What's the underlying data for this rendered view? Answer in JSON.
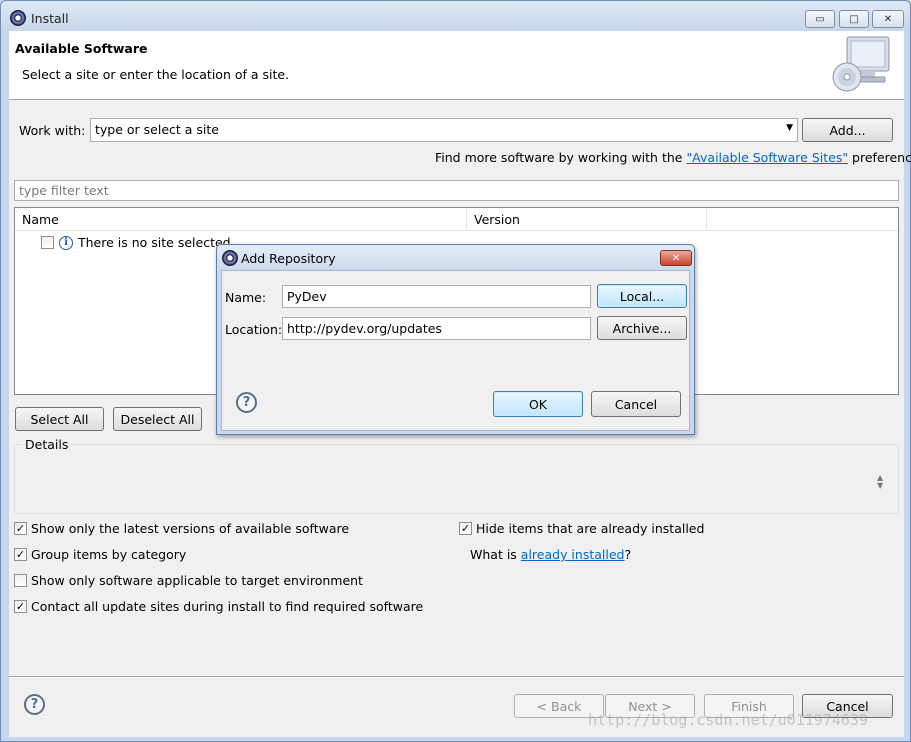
{
  "window": {
    "title": "Install",
    "min_glyph": "▭",
    "max_glyph": "□",
    "close_glyph": "✕"
  },
  "banner": {
    "title": "Available Software",
    "description": "Select a site or enter the location of a site."
  },
  "work_with": {
    "label": "Work with:",
    "value": "type or select a site",
    "add_button": "Add...",
    "info_prefix": "Find more software by working with the ",
    "info_link": "\"Available Software Sites\"",
    "info_suffix": " preferences."
  },
  "filter": {
    "placeholder": "type filter text"
  },
  "table": {
    "columns": [
      "Name",
      "Version"
    ],
    "empty_message": "There is no site selected."
  },
  "selection_buttons": {
    "select_all": "Select All",
    "deselect_all": "Deselect All"
  },
  "details": {
    "legend": "Details"
  },
  "options": {
    "latest_versions": {
      "label": "Show only the latest versions of available software",
      "checked": true
    },
    "group_by_category": {
      "label": "Group items by category",
      "checked": true
    },
    "target_env": {
      "label": "Show only software applicable to target environment",
      "checked": false
    },
    "contact_sites": {
      "label": "Contact all update sites during install to find required software",
      "checked": true
    },
    "hide_installed": {
      "label": "Hide items that are already installed",
      "checked": true
    },
    "what_is_prefix": "What is ",
    "what_is_link": "already installed",
    "what_is_suffix": "?"
  },
  "footer": {
    "back": "< Back",
    "next": "Next >",
    "finish": "Finish",
    "cancel": "Cancel"
  },
  "dialog": {
    "title": "Add Repository",
    "close_glyph": "✕",
    "name_label": "Name:",
    "name_value": "PyDev",
    "location_label": "Location:",
    "location_value": "http://pydev.org/updates",
    "local_button": "Local...",
    "archive_button": "Archive...",
    "ok_button": "OK",
    "cancel_button": "Cancel"
  },
  "watermark": "http://blog.csdn.net/u011974639"
}
